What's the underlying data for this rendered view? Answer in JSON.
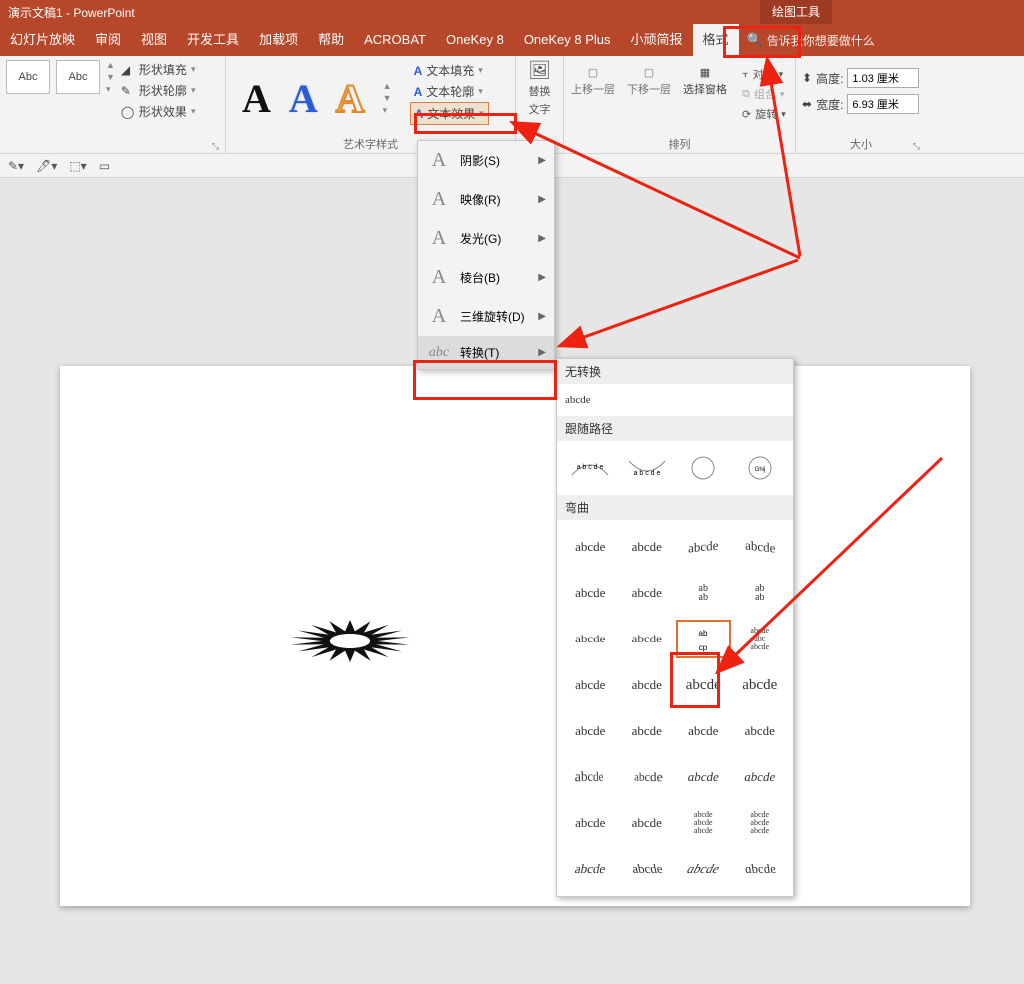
{
  "title": "演示文稿1 - PowerPoint",
  "context_tool_tab": "绘图工具",
  "tabs": {
    "slideshow": "幻灯片放映",
    "review": "审阅",
    "view": "视图",
    "developer": "开发工具",
    "addins": "加载项",
    "help": "帮助",
    "acrobat": "ACROBAT",
    "onekey8": "OneKey 8",
    "onekey8plus": "OneKey 8 Plus",
    "xwjb": "小顽简报",
    "format": "格式",
    "tellme": "告诉我你想要做什么"
  },
  "shape_styles": {
    "sample": "Abc",
    "fill": "形状填充",
    "outline": "形状轮廓",
    "effects": "形状效果"
  },
  "wordart": {
    "group_label": "艺术字样式",
    "text_fill": "文本填充",
    "text_outline": "文本轮廓",
    "text_effects": "文本效果"
  },
  "replace_text": {
    "l1": "替换",
    "l2": "文字"
  },
  "arrange": {
    "bring_forward": "上移一层",
    "send_backward": "下移一层",
    "selection_pane": "选择窗格",
    "align": "对齐",
    "group": "组合",
    "rotate": "旋转",
    "group_label": "排列"
  },
  "size": {
    "height_label": "高度:",
    "width_label": "宽度:",
    "height_value": "1.03 厘米",
    "width_value": "6.93 厘米",
    "group_label": "大小"
  },
  "effects_menu": {
    "shadow": "阴影(S)",
    "reflection": "映像(R)",
    "glow": "发光(G)",
    "bevel": "棱台(B)",
    "rotation3d": "三维旋转(D)",
    "transform": "转换(T)"
  },
  "transform_gallery": {
    "no_transform": "无转换",
    "sample_text": "abcde",
    "follow_path": "跟随路径",
    "warp": "弯曲"
  }
}
